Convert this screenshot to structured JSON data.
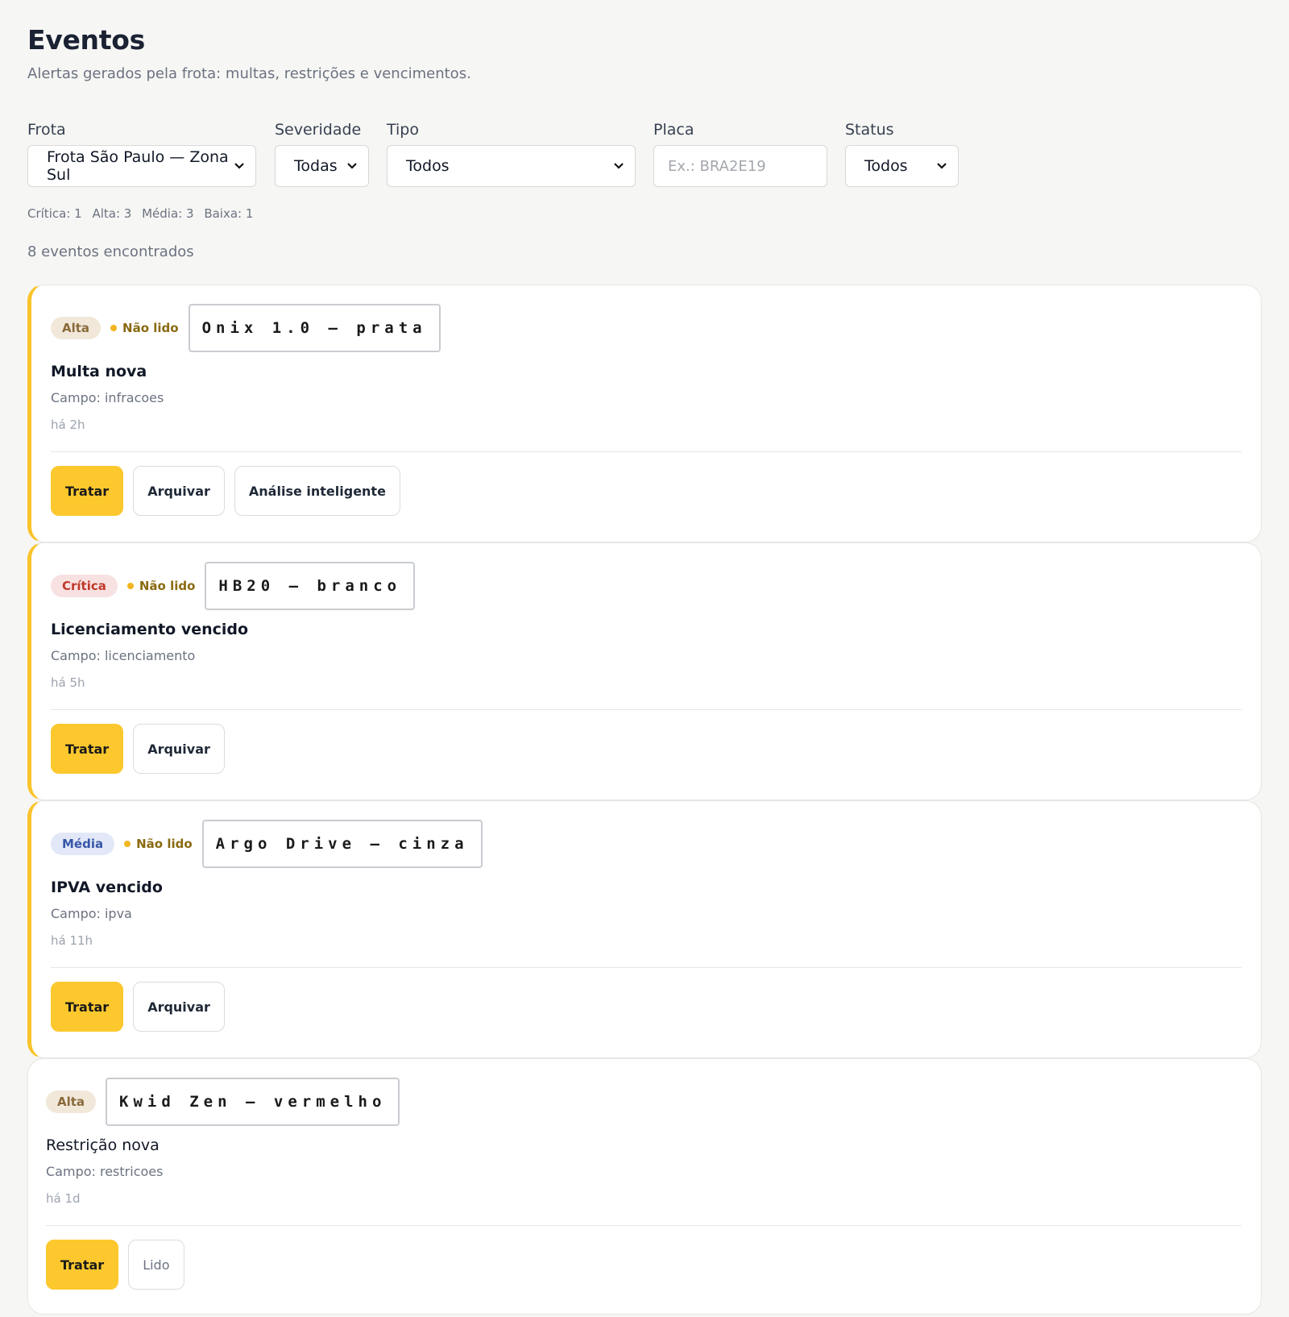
{
  "header": {
    "title": "Eventos",
    "subtitle": "Alertas gerados pela frota: multas, restrições e vencimentos."
  },
  "filters": {
    "frota": {
      "label": "Frota",
      "value": "Frota São Paulo — Zona Sul"
    },
    "severidade": {
      "label": "Severidade",
      "value": "Todas"
    },
    "tipo": {
      "label": "Tipo",
      "value": "Todos"
    },
    "placa": {
      "label": "Placa",
      "placeholder": "Ex.: BRA2E19"
    },
    "status": {
      "label": "Status",
      "value": "Todos"
    }
  },
  "counts": {
    "critica": "Crítica: 1",
    "alta": "Alta: 3",
    "media": "Média: 3",
    "baixa": "Baixa: 1"
  },
  "found": "8 eventos encontrados",
  "events": [
    {
      "severity": "Alta",
      "unread": "Não lido",
      "vehicle": "Onix 1.0 — prata",
      "title": "Multa nova",
      "field": "Campo: infracoes",
      "time": "há 2h",
      "actions": [
        "Tratar",
        "Arquivar",
        "Análise inteligente"
      ]
    },
    {
      "severity": "Crítica",
      "unread": "Não lido",
      "vehicle": "HB20 — branco",
      "title": "Licenciamento vencido",
      "field": "Campo: licenciamento",
      "time": "há 5h",
      "actions": [
        "Tratar",
        "Arquivar"
      ]
    },
    {
      "severity": "Média",
      "unread": "Não lido",
      "vehicle": "Argo Drive — cinza",
      "title": "IPVA vencido",
      "field": "Campo: ipva",
      "time": "há 11h",
      "actions": [
        "Tratar",
        "Arquivar"
      ]
    },
    {
      "severity": "Alta",
      "vehicle": "Kwid Zen — vermelho",
      "title": "Restrição nova",
      "field": "Campo: restricoes",
      "time": "há 1d",
      "actions": [
        "Tratar",
        "Lido"
      ]
    }
  ],
  "colors": {
    "accent": "#fcc82e",
    "alta_bg": "#f1e8da",
    "critica_bg": "#f8e1e1",
    "media_bg": "#e2e8f7",
    "unread_dot": "#f2b51e"
  },
  "icons": {
    "select_chevron": "chevron-down-icon"
  }
}
